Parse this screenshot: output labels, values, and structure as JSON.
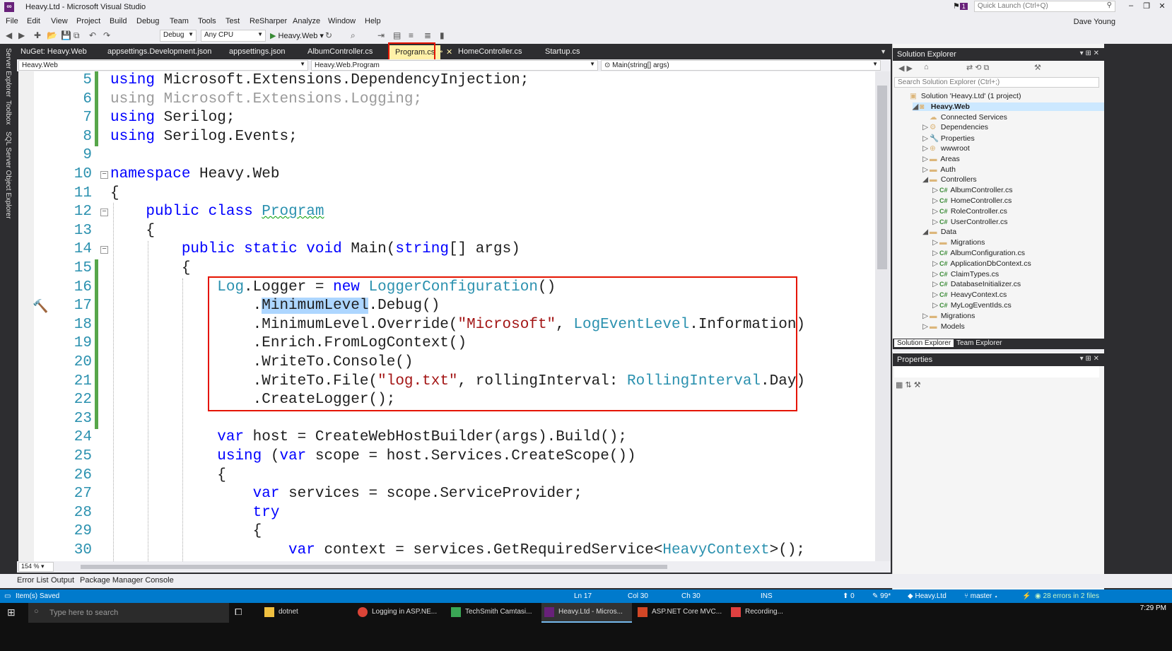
{
  "window": {
    "title": "Heavy.Ltd - Microsoft Visual Studio",
    "notification_count": "1",
    "quick_launch_placeholder": "Quick Launch (Ctrl+Q)"
  },
  "menu": [
    "File",
    "Edit",
    "View",
    "Project",
    "Build",
    "Debug",
    "Team",
    "Tools",
    "Test",
    "ReSharper",
    "Analyze",
    "Window",
    "Help"
  ],
  "user": "Dave Young",
  "toolbar": {
    "configuration": "Debug",
    "platform": "Any CPU",
    "run_target": "Heavy.Web"
  },
  "left_side_tabs": [
    "Server Explorer",
    "Toolbox",
    "SQL Server Object Explorer"
  ],
  "doc_tabs": [
    {
      "label": "NuGet: Heavy.Web"
    },
    {
      "label": "appsettings.Development.json"
    },
    {
      "label": "appsettings.json"
    },
    {
      "label": "AlbumController.cs"
    },
    {
      "label": "Program.cs"
    },
    {
      "label": "HomeController.cs"
    },
    {
      "label": "Startup.cs"
    }
  ],
  "nav": {
    "project": "Heavy.Web",
    "type": "Heavy.Web.Program",
    "member": "Main(string[] args)"
  },
  "code_lines": [
    {
      "n": "5",
      "t": "using Microsoft.Extensions.DependencyInjection;"
    },
    {
      "n": "6",
      "t": "using Microsoft.Extensions.Logging;"
    },
    {
      "n": "7",
      "t": "using Serilog;"
    },
    {
      "n": "8",
      "t": "using Serilog.Events;"
    },
    {
      "n": "9",
      "t": ""
    },
    {
      "n": "10",
      "t": "namespace Heavy.Web"
    },
    {
      "n": "11",
      "t": "{"
    },
    {
      "n": "12",
      "t": "    public class Program"
    },
    {
      "n": "13",
      "t": "    {"
    },
    {
      "n": "14",
      "t": "        public static void Main(string[] args)"
    },
    {
      "n": "15",
      "t": "        {"
    },
    {
      "n": "16",
      "t": "            Log.Logger = new LoggerConfiguration()"
    },
    {
      "n": "17",
      "t": "                .MinimumLevel.Debug()"
    },
    {
      "n": "18",
      "t": "                .MinimumLevel.Override(\"Microsoft\", LogEventLevel.Information)"
    },
    {
      "n": "19",
      "t": "                .Enrich.FromLogContext()"
    },
    {
      "n": "20",
      "t": "                .WriteTo.Console()"
    },
    {
      "n": "21",
      "t": "                .WriteTo.File(\"log.txt\", rollingInterval: RollingInterval.Day)"
    },
    {
      "n": "22",
      "t": "                .CreateLogger();"
    },
    {
      "n": "23",
      "t": ""
    },
    {
      "n": "24",
      "t": "            var host = CreateWebHostBuilder(args).Build();"
    },
    {
      "n": "25",
      "t": "            using (var scope = host.Services.CreateScope())"
    },
    {
      "n": "26",
      "t": "            {"
    },
    {
      "n": "27",
      "t": "                var services = scope.ServiceProvider;"
    },
    {
      "n": "28",
      "t": "                try"
    },
    {
      "n": "29",
      "t": "                {"
    },
    {
      "n": "30",
      "t": "                    var context = services.GetRequiredService<HeavyContext>();"
    }
  ],
  "zoom": "154 %",
  "solution_explorer": {
    "title": "Solution Explorer",
    "search_placeholder": "Search Solution Explorer (Ctrl+;)",
    "items": [
      {
        "label": "Solution 'Heavy.Ltd' (1 project)",
        "indent": 0,
        "icon": "solution-icon",
        "exp": "",
        "cs": false
      },
      {
        "label": "Heavy.Web",
        "indent": 1,
        "icon": "project-icon",
        "exp": "◢",
        "cs": false,
        "selected": true
      },
      {
        "label": "Connected Services",
        "indent": 2,
        "icon": "connected-services-icon",
        "exp": "",
        "cs": false
      },
      {
        "label": "Dependencies",
        "indent": 2,
        "icon": "dependencies-icon",
        "exp": "▷",
        "cs": false
      },
      {
        "label": "Properties",
        "indent": 2,
        "icon": "wrench-icon",
        "exp": "▷",
        "cs": false
      },
      {
        "label": "wwwroot",
        "indent": 2,
        "icon": "globe-icon",
        "exp": "▷",
        "cs": false
      },
      {
        "label": "Areas",
        "indent": 2,
        "icon": "folder-icon",
        "exp": "▷",
        "cs": false
      },
      {
        "label": "Auth",
        "indent": 2,
        "icon": "folder-icon",
        "exp": "▷",
        "cs": false
      },
      {
        "label": "Controllers",
        "indent": 2,
        "icon": "folder-icon",
        "exp": "◢",
        "cs": false
      },
      {
        "label": "AlbumController.cs",
        "indent": 3,
        "icon": "csharp-file-icon",
        "exp": "▷",
        "cs": true
      },
      {
        "label": "HomeController.cs",
        "indent": 3,
        "icon": "csharp-file-icon",
        "exp": "▷",
        "cs": true
      },
      {
        "label": "RoleController.cs",
        "indent": 3,
        "icon": "csharp-file-icon",
        "exp": "▷",
        "cs": true
      },
      {
        "label": "UserController.cs",
        "indent": 3,
        "icon": "csharp-file-icon",
        "exp": "▷",
        "cs": true
      },
      {
        "label": "Data",
        "indent": 2,
        "icon": "folder-icon",
        "exp": "◢",
        "cs": false
      },
      {
        "label": "Migrations",
        "indent": 3,
        "icon": "folder-icon",
        "exp": "▷",
        "cs": false
      },
      {
        "label": "AlbumConfiguration.cs",
        "indent": 3,
        "icon": "csharp-file-icon",
        "exp": "▷",
        "cs": true
      },
      {
        "label": "ApplicationDbContext.cs",
        "indent": 3,
        "icon": "csharp-file-icon",
        "exp": "▷",
        "cs": true
      },
      {
        "label": "ClaimTypes.cs",
        "indent": 3,
        "icon": "csharp-file-icon",
        "exp": "▷",
        "cs": true
      },
      {
        "label": "DatabaseInitializer.cs",
        "indent": 3,
        "icon": "csharp-file-icon",
        "exp": "▷",
        "cs": true
      },
      {
        "label": "HeavyContext.cs",
        "indent": 3,
        "icon": "csharp-file-icon",
        "exp": "▷",
        "cs": true
      },
      {
        "label": "MyLogEventIds.cs",
        "indent": 3,
        "icon": "csharp-file-icon",
        "exp": "▷",
        "cs": true
      },
      {
        "label": "Migrations",
        "indent": 2,
        "icon": "folder-icon",
        "exp": "▷",
        "cs": false
      },
      {
        "label": "Models",
        "indent": 2,
        "icon": "folder-icon",
        "exp": "▷",
        "cs": false
      }
    ],
    "tabs": [
      "Solution Explorer",
      "Team Explorer"
    ]
  },
  "properties": {
    "title": "Properties"
  },
  "tool_windows": [
    "Error List",
    "Output",
    "Package Manager Console"
  ],
  "status": {
    "message": "Item(s) Saved",
    "line": "Ln 17",
    "col": "Col 30",
    "ch": "Ch 30",
    "mode": "INS",
    "up_count": "0",
    "pencil_count": "99*",
    "repo": "Heavy.Ltd",
    "branch": "master",
    "errors": "28 errors in 2 files"
  },
  "taskbar": {
    "search_placeholder": "Type here to search",
    "apps": [
      "dotnet",
      "Logging in ASP.NE...",
      "TechSmith Camtasi...",
      "Heavy.Ltd - Micros...",
      "ASP.NET Core MVC...",
      "Recording..."
    ],
    "time": "7:29 PM"
  },
  "colors": {
    "keyword": "#0000ff",
    "type": "#2b91af",
    "string": "#a31515",
    "highlight_box": "#e51400",
    "statusbar": "#007acc"
  }
}
